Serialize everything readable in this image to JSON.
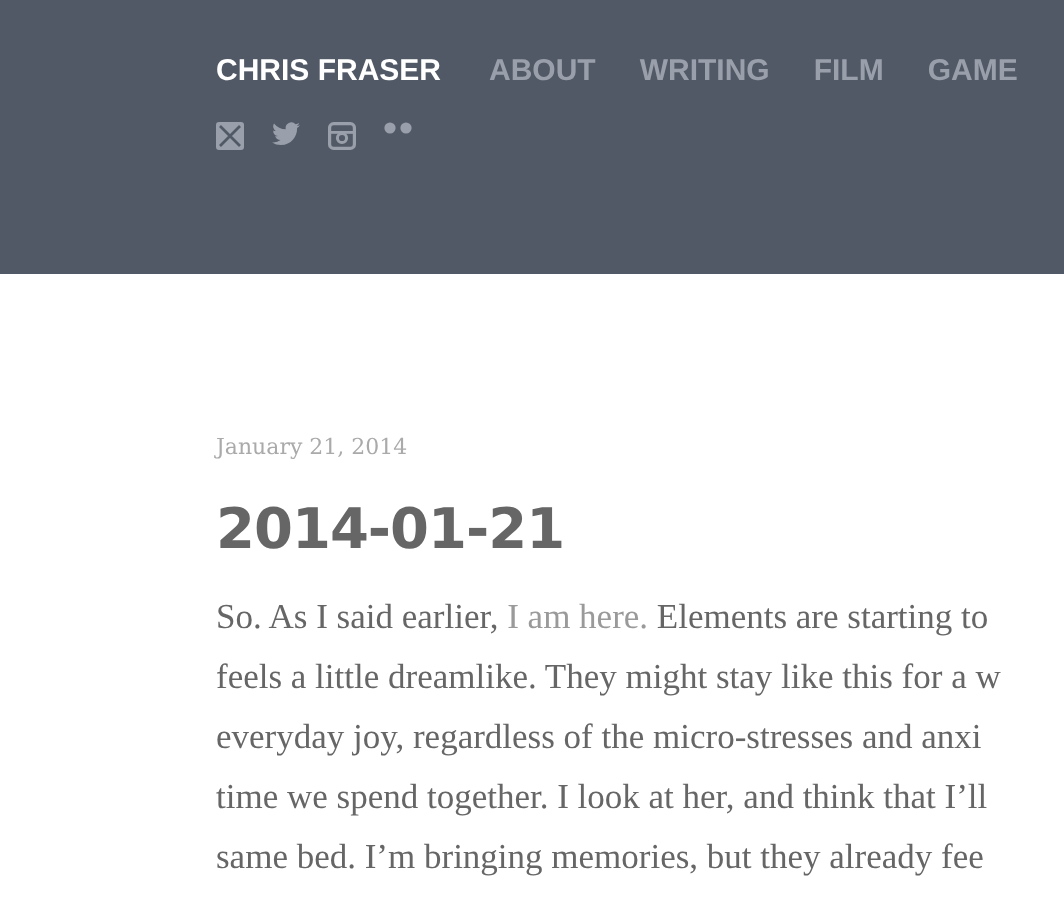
{
  "header": {
    "site_title": "CHRIS FRASER",
    "nav": [
      {
        "label": "ABOUT"
      },
      {
        "label": "WRITING"
      },
      {
        "label": "FILM"
      },
      {
        "label": "GAME"
      }
    ],
    "social": [
      {
        "kind": "mail"
      },
      {
        "kind": "twitter"
      },
      {
        "kind": "instagram"
      },
      {
        "kind": "flickr"
      }
    ]
  },
  "post": {
    "date": "January 21, 2014",
    "title": "2014-01-21",
    "lines": [
      {
        "before": "So. As I said earlier, ",
        "link": "I am here.",
        "after": " Elements are starting to"
      },
      {
        "before": "feels a little dreamlike. They might stay like this for a w"
      },
      {
        "before": "everyday joy, regardless of the micro-stresses and anxi"
      },
      {
        "before": "time we spend together. I look at her, and think that I’ll"
      },
      {
        "before": "same bed. I’m bringing memories, but they already fee"
      }
    ]
  }
}
